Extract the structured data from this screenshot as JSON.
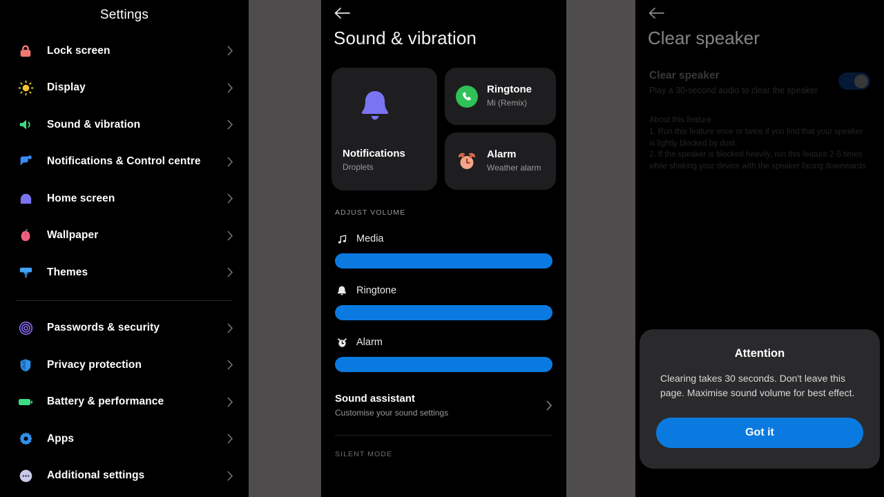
{
  "settings_panel": {
    "title": "Settings",
    "items": [
      {
        "label": "Lock screen",
        "icon": "lock-icon",
        "color": "#f07a72"
      },
      {
        "label": "Display",
        "icon": "brightness-icon",
        "color": "#f5c430"
      },
      {
        "label": "Sound & vibration",
        "icon": "speaker-icon",
        "color": "#3ddc84"
      },
      {
        "label": "Notifications & Control centre",
        "icon": "notification-icon",
        "color": "#3b8cf5"
      },
      {
        "label": "Home screen",
        "icon": "home-icon",
        "color": "#7b74f0"
      },
      {
        "label": "Wallpaper",
        "icon": "flower-icon",
        "color": "#f2607f"
      },
      {
        "label": "Themes",
        "icon": "paint-roller-icon",
        "color": "#3fa4f7"
      }
    ],
    "items_group2": [
      {
        "label": "Passwords & security",
        "icon": "fingerprint-icon",
        "color": "#8f6bf2"
      },
      {
        "label": "Privacy protection",
        "icon": "shield-icon",
        "color": "#2f90e8"
      },
      {
        "label": "Battery & performance",
        "icon": "battery-icon",
        "color": "#3ddc84"
      },
      {
        "label": "Apps",
        "icon": "gear-icon",
        "color": "#2f90e8"
      },
      {
        "label": "Additional settings",
        "icon": "ellipsis-bubble-icon",
        "color": "#c9cbe8"
      }
    ],
    "chevron_icon": "chevron-right-icon"
  },
  "sound_panel": {
    "back_icon": "back-arrow-icon",
    "title": "Sound & vibration",
    "tiles": {
      "notifications": {
        "icon": "bell-icon",
        "title": "Notifications",
        "subtitle": "Droplets"
      },
      "ringtone": {
        "icon": "phone-icon",
        "title": "Ringtone",
        "subtitle": "Mi (Remix)"
      },
      "alarm": {
        "icon": "alarm-clock-icon",
        "title": "Alarm",
        "subtitle": "Weather alarm"
      }
    },
    "adjust_volume_caption": "ADJUST VOLUME",
    "sliders": [
      {
        "label": "Media",
        "icon": "music-note-icon",
        "value": 100
      },
      {
        "label": "Ringtone",
        "icon": "bell-icon",
        "value": 100
      },
      {
        "label": "Alarm",
        "icon": "alarm-clock-icon",
        "value": 100
      }
    ],
    "sound_assistant": {
      "title": "Sound assistant",
      "subtitle": "Customise your sound settings",
      "chevron_icon": "chevron-right-icon"
    },
    "silent_mode_caption": "SILENT MODE"
  },
  "speaker_panel": {
    "back_icon": "back-arrow-icon",
    "title": "Clear speaker",
    "setting": {
      "title": "Clear speaker",
      "subtitle": "Play a 30-second audio to clear the speaker",
      "toggle_on": true
    },
    "about_heading": "About this feature",
    "about_lines": [
      "1. Run this feature once or twice if you find that your speaker is lightly blocked by dust.",
      "2. If the speaker is blocked heavily, run this feature 2-5 times while shaking your device with the speaker facing downwards."
    ]
  },
  "dialog": {
    "title": "Attention",
    "body": "Clearing takes 30 seconds. Don't leave this page. Maximise sound volume for best effect.",
    "button_label": "Got it"
  },
  "colors": {
    "accent_blue": "#0b7ae0",
    "panel_bg": "#000000",
    "stage_bg": "#4e4c4d",
    "card_bg": "#1e1e20",
    "dialog_bg": "#2a2a2c"
  }
}
